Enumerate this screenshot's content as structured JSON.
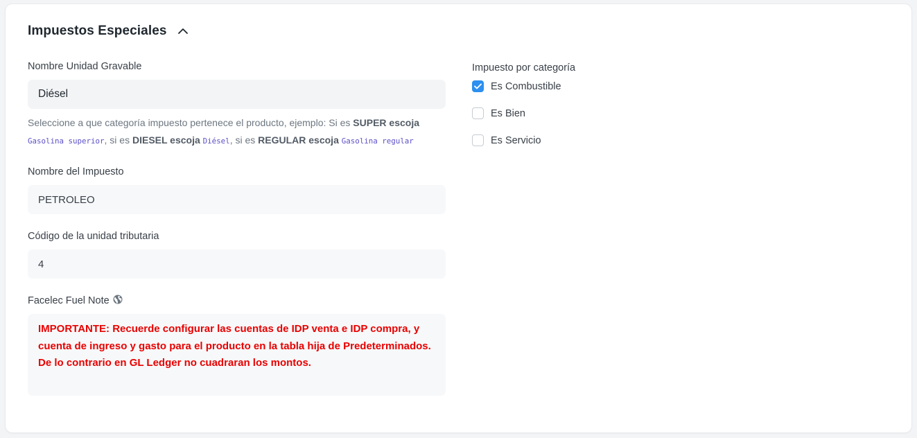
{
  "section": {
    "title": "Impuestos Especiales",
    "collapse_icon": "chevron-up-icon"
  },
  "fields": {
    "unidad_gravable": {
      "label": "Nombre Unidad Gravable",
      "value": "Diésel",
      "help": {
        "t1": "Seleccione a que categoría impuesto pertenece el producto, ejemplo: Si es ",
        "b1": "SUPER escoja",
        "c1": "Gasolina superior",
        "t2": ", si es ",
        "b2": "DIESEL escoja",
        "c2": "Diésel",
        "t3": ", si es ",
        "b3": "REGULAR escoja",
        "c3": "Gasolina regular"
      }
    },
    "nombre_impuesto": {
      "label": "Nombre del Impuesto",
      "value": "PETROLEO"
    },
    "codigo_unidad": {
      "label": "Código de la unidad tributaria",
      "value": "4"
    },
    "fuel_note": {
      "label": "Facelec Fuel Note",
      "label_icon": "globe-icon",
      "text": "IMPORTANTE: Recuerde configurar las cuentas de IDP venta e IDP compra, y cuenta de ingreso y gasto para el producto en la tabla hija de Predeterminados. De lo contrario en GL Ledger no cuadraran los montos.",
      "color": "#e80000"
    }
  },
  "categoria": {
    "label": "Impuesto por categoría",
    "options": [
      {
        "label": "Es Combustible",
        "checked": true
      },
      {
        "label": "Es Bien",
        "checked": false
      },
      {
        "label": "Es Servicio",
        "checked": false
      }
    ],
    "accent": "#2d8fef"
  }
}
